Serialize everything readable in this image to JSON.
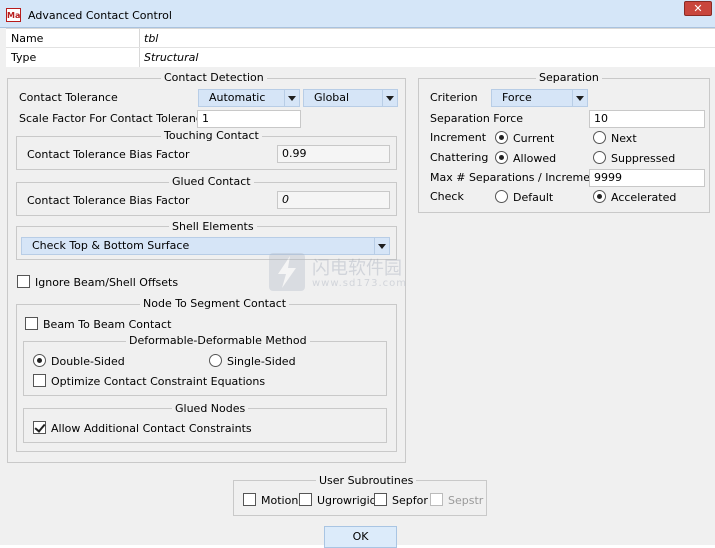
{
  "window": {
    "title": "Advanced Contact Control",
    "icon_text": "Ma",
    "close_glyph": "✕"
  },
  "name": {
    "label": "Name",
    "value": "tbl"
  },
  "type": {
    "label": "Type",
    "value": "Structural"
  },
  "contact_detection": {
    "title": "Contact Detection",
    "tolerance_label": "Contact Tolerance",
    "tolerance_mode": "Automatic",
    "tolerance_scope": "Global",
    "scale_factor_label": "Scale Factor For Contact Tolerance",
    "scale_factor_value": "1",
    "touching": {
      "title": "Touching Contact",
      "bias_label": "Contact Tolerance Bias Factor",
      "bias_value": "0.99"
    },
    "glued": {
      "title": "Glued Contact",
      "bias_label": "Contact Tolerance Bias Factor",
      "bias_value": "0"
    },
    "shell": {
      "title": "Shell Elements",
      "option": "Check Top & Bottom Surface"
    },
    "ignore_offsets_label": "Ignore Beam/Shell Offsets",
    "nts": {
      "title": "Node To Segment Contact",
      "beam_to_beam_label": "Beam To Beam Contact",
      "dd_method": {
        "title": "Deformable-Deformable Method",
        "double_sided": "Double-Sided",
        "single_sided": "Single-Sided",
        "optimize_label": "Optimize Contact Constraint Equations"
      },
      "glued_nodes": {
        "title": "Glued Nodes",
        "allow_label": "Allow Additional Contact Constraints"
      }
    }
  },
  "separation": {
    "title": "Separation",
    "criterion_label": "Criterion",
    "criterion_value": "Force",
    "force_label": "Separation Force",
    "force_value": "10",
    "increment_label": "Increment",
    "increment_current": "Current",
    "increment_next": "Next",
    "chattering_label": "Chattering",
    "chattering_allowed": "Allowed",
    "chattering_suppressed": "Suppressed",
    "max_label": "Max # Separations / Increment",
    "max_value": "9999",
    "check_label": "Check",
    "check_default": "Default",
    "check_accelerated": "Accelerated"
  },
  "user_subroutines": {
    "title": "User Subroutines",
    "motion": "Motion",
    "ugrowrigid": "Ugrowrigid",
    "sepfor": "Sepfor",
    "sepstr": "Sepstr"
  },
  "ok_label": "OK",
  "watermark": {
    "cn": "闪电软件园",
    "url": "www.sd173.com"
  }
}
